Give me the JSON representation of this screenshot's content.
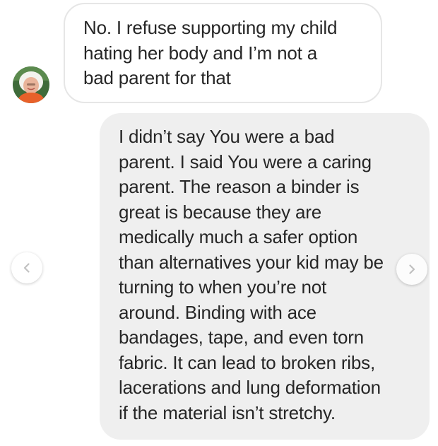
{
  "conversation": {
    "received_message": {
      "text": "No. I refuse supporting my child\nhating her body and I’m not a\nbad parent for that"
    },
    "sent_message": {
      "text": "I didn’t say You were a bad\nparent. I said You were a caring\nparent. The reason a binder is\ngreat is because they are\nmedically much a safer option\nthan alternatives your kid may be\nturning to when you’re not\naround. Binding with ace\nbandages, tape, and even torn\nfabric. It can lead to broken ribs,\nlacerations and lung deformation\nif the material isn’t stretchy."
    }
  },
  "colors": {
    "received_bubble_border": "#e6e6e6",
    "sent_bubble_background": "#efefef",
    "text": "#262626"
  },
  "icons": {
    "previous": "chevron-left-icon",
    "next": "chevron-right-icon",
    "sender_avatar": "avatar"
  }
}
